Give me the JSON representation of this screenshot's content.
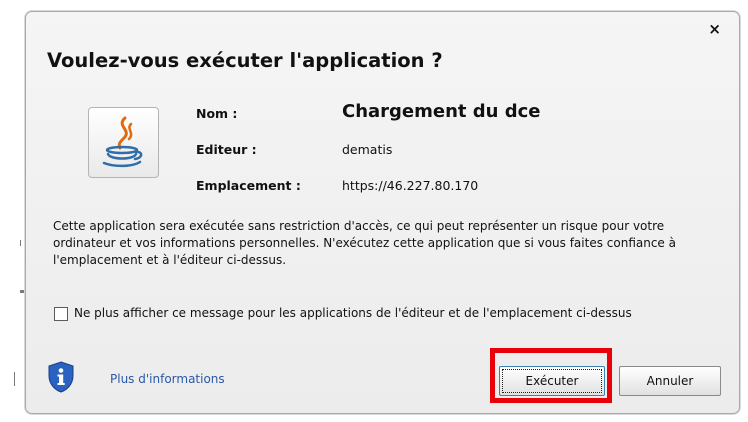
{
  "dialog": {
    "title": "Voulez-vous exécuter l'application ?",
    "close_glyph": "×",
    "icon": "java-coffee-icon"
  },
  "details": {
    "name_label": "Nom :",
    "name_value": "Chargement du dce",
    "publisher_label": "Editeur :",
    "publisher_value": "dematis",
    "location_label": "Emplacement :",
    "location_value": "https://46.227.80.170"
  },
  "warning_text": "Cette application sera exécutée sans restriction d'accès, ce qui peut représenter un risque pour votre ordinateur et vos informations personnelles. N'exécutez cette application que si vous faites confiance à l'emplacement et à l'éditeur ci-dessus.",
  "checkbox": {
    "label": "Ne plus afficher ce message pour les applications de l'éditeur et de l'emplacement ci-dessus",
    "checked": false
  },
  "footer": {
    "info_icon": "shield-info-icon",
    "more_info_label": "Plus d'informations",
    "run_label": "Exécuter",
    "cancel_label": "Annuler"
  },
  "colors": {
    "highlight": "#e8000b",
    "link": "#2b58a8",
    "shield": "#2a62c2"
  }
}
